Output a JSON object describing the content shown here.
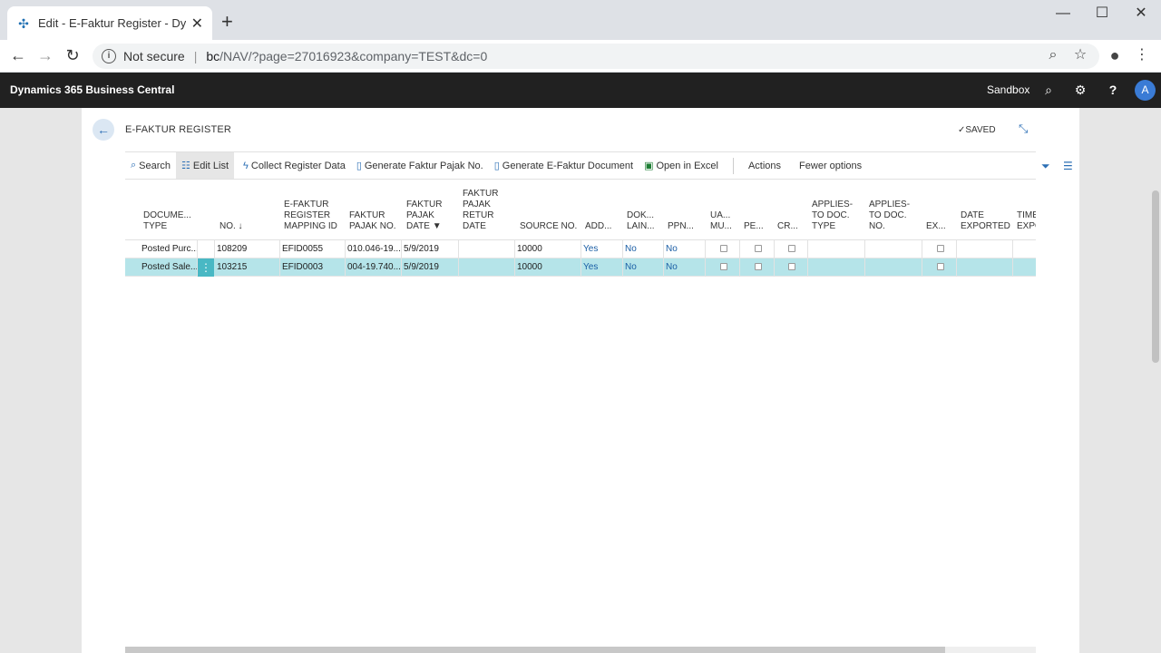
{
  "browser": {
    "tab_title": "Edit - E-Faktur Register - Dynami",
    "security_label": "Not secure",
    "url_host": "bc",
    "url_path": "/NAV/?page=27016923&company=TEST&dc=0"
  },
  "header": {
    "brand": "Dynamics 365 Business Central",
    "environment": "Sandbox",
    "avatar_letter": "A"
  },
  "page": {
    "title": "E-FAKTUR REGISTER",
    "status": "SAVED"
  },
  "actions": {
    "search": "Search",
    "edit_list": "Edit List",
    "collect": "Collect Register Data",
    "gen_faktur": "Generate Faktur Pajak No.",
    "gen_doc": "Generate E-Faktur Document",
    "open_excel": "Open in Excel",
    "actions": "Actions",
    "fewer": "Fewer options"
  },
  "columns": {
    "doc_type_1": "DOCUME...",
    "doc_type_2": "TYPE",
    "no": "NO. ↓",
    "mapping_1": "E-FAKTUR",
    "mapping_2": "REGISTER",
    "mapping_3": "MAPPING ID",
    "fpno_1": "FAKTUR",
    "fpno_2": "PAJAK NO.",
    "fpdate_1": "FAKTUR",
    "fpdate_2": "PAJAK",
    "fpdate_3": "DATE ▼",
    "retur_1": "FAKTUR",
    "retur_2": "PAJAK",
    "retur_3": "RETUR",
    "retur_4": "DATE",
    "source": "SOURCE NO.",
    "add": "ADD...",
    "dok_1": "DOK...",
    "dok_2": "LAIN...",
    "ppn": "PPN...",
    "ua_1": "UA...",
    "ua_2": "MU...",
    "pe": "PE...",
    "cr": "CR...",
    "apt_1": "APPLIES-",
    "apt_2": "TO DOC.",
    "apt_3": "TYPE",
    "apn_1": "APPLIES-",
    "apn_2": "TO DOC.",
    "apn_3": "NO.",
    "ex": "EX...",
    "de_1": "DATE",
    "de_2": "EXPORTED",
    "te_1": "TIME",
    "te_2": "EXPO"
  },
  "rows": [
    {
      "doc_type": "Posted Purc...",
      "no": "108209",
      "mapping_id": "EFID0055",
      "fp_no": "010.046-19....",
      "fp_date": "5/9/2019",
      "source_no": "10000",
      "add": "Yes",
      "dok": "No",
      "ppn": "No"
    },
    {
      "doc_type": "Posted Sale...",
      "no": "103215",
      "mapping_id": "EFID0003",
      "fp_no": "004-19.740....",
      "fp_date": "5/9/2019",
      "source_no": "10000",
      "add": "Yes",
      "dok": "No",
      "ppn": "No"
    }
  ]
}
